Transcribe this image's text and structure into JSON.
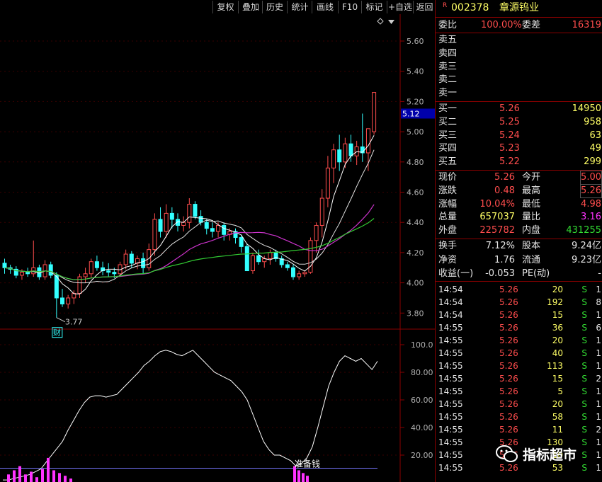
{
  "toolbar": {
    "buttons": [
      "复权",
      "叠加",
      "历史",
      "统计",
      "画线",
      "F10",
      "标记",
      "+自选",
      "返回"
    ]
  },
  "price_axis": {
    "ticks": [
      "5.60",
      "5.40",
      "5.20",
      "5.00",
      "4.80",
      "4.60",
      "4.40",
      "4.20",
      "4.00",
      "3.80"
    ],
    "current_price_tag": "5.12",
    "low_label": "3.77",
    "fin_marker": "财"
  },
  "indicator_axis": {
    "ticks": [
      "100.0",
      "80.00",
      "60.00",
      "40.00",
      "20.00"
    ],
    "bottom_label": "准备钱"
  },
  "colors": {
    "up": "#ff4d4d",
    "down": "#33ffff",
    "ma_white": "#ffffff",
    "ma_magenta": "#cc33cc",
    "ma_green": "#33cc33",
    "frame": "#8a0000"
  },
  "stock": {
    "prefix": "R",
    "code": "002378",
    "name": "章源钨业"
  },
  "ratio": {
    "wb_label": "委比",
    "wb_value": "100.00%",
    "wc_label": "委差",
    "wc_value": "16319"
  },
  "sells": [
    {
      "label": "卖五",
      "price": "",
      "vol": ""
    },
    {
      "label": "卖四",
      "price": "",
      "vol": ""
    },
    {
      "label": "卖三",
      "price": "",
      "vol": ""
    },
    {
      "label": "卖二",
      "price": "",
      "vol": ""
    },
    {
      "label": "卖一",
      "price": "",
      "vol": ""
    }
  ],
  "buys": [
    {
      "label": "买一",
      "price": "5.26",
      "vol": "14950"
    },
    {
      "label": "买二",
      "price": "5.25",
      "vol": "958"
    },
    {
      "label": "买三",
      "price": "5.24",
      "vol": "63"
    },
    {
      "label": "买四",
      "price": "5.23",
      "vol": "49"
    },
    {
      "label": "买五",
      "price": "5.22",
      "vol": "299"
    }
  ],
  "stats": [
    {
      "l1": "现价",
      "v1": "5.26",
      "l2": "今开",
      "v2": "5.00"
    },
    {
      "l1": "涨跌",
      "v1": "0.48",
      "l2": "最高",
      "v2": "5.26"
    },
    {
      "l1": "涨幅",
      "v1": "10.04%",
      "l2": "最低",
      "v2": "4.98"
    },
    {
      "l1": "总量",
      "v1": "657037",
      "l2": "量比",
      "v2": "3.16"
    },
    {
      "l1": "外盘",
      "v1": "225782",
      "l2": "内盘",
      "v2": "431255"
    }
  ],
  "stats2": [
    {
      "l1": "换手",
      "v1": "7.12%",
      "l2": "股本",
      "v2": "9.24亿"
    },
    {
      "l1": "净资",
      "v1": "1.76",
      "l2": "流通",
      "v2": "9.23亿"
    },
    {
      "l1": "收益(一)",
      "v1": "-0.053",
      "l2": "PE(动)",
      "v2": "-"
    }
  ],
  "ticks": [
    {
      "t": "14:54",
      "p": "5.26",
      "v": "20",
      "s": "S",
      "n": "1"
    },
    {
      "t": "14:54",
      "p": "5.26",
      "v": "192",
      "s": "S",
      "n": "8"
    },
    {
      "t": "14:54",
      "p": "5.26",
      "v": "15",
      "s": "S",
      "n": "1"
    },
    {
      "t": "14:55",
      "p": "5.26",
      "v": "36",
      "s": "S",
      "n": "6"
    },
    {
      "t": "14:55",
      "p": "5.26",
      "v": "20",
      "s": "S",
      "n": "1"
    },
    {
      "t": "14:55",
      "p": "5.26",
      "v": "40",
      "s": "S",
      "n": "1"
    },
    {
      "t": "14:55",
      "p": "5.26",
      "v": "113",
      "s": "S",
      "n": "1"
    },
    {
      "t": "14:55",
      "p": "5.26",
      "v": "15",
      "s": "S",
      "n": "2"
    },
    {
      "t": "14:55",
      "p": "5.26",
      "v": "5",
      "s": "S",
      "n": "1"
    },
    {
      "t": "14:55",
      "p": "5.26",
      "v": "20",
      "s": "S",
      "n": "1"
    },
    {
      "t": "14:55",
      "p": "5.26",
      "v": "58",
      "s": "S",
      "n": "1"
    },
    {
      "t": "14:55",
      "p": "5.26",
      "v": "11",
      "s": "S",
      "n": "2"
    },
    {
      "t": "14:55",
      "p": "5.26",
      "v": "130",
      "s": "S",
      "n": "1"
    },
    {
      "t": "14:55",
      "p": "5.26",
      "v": "10",
      "s": "S",
      "n": "1"
    },
    {
      "t": "14:55",
      "p": "5.26",
      "v": "53",
      "s": "S",
      "n": "1"
    }
  ],
  "watermark": "指标超市",
  "chart_data": {
    "type": "candlestick",
    "ylim": [
      3.7,
      5.72
    ],
    "candles": [
      [
        4.13,
        4.16,
        4.06,
        4.1
      ],
      [
        4.1,
        4.12,
        4.06,
        4.09
      ],
      [
        4.09,
        4.11,
        4.03,
        4.05
      ],
      [
        4.05,
        4.09,
        4.02,
        4.07
      ],
      [
        4.07,
        4.1,
        4.04,
        4.06
      ],
      [
        4.06,
        4.28,
        4.04,
        4.1
      ],
      [
        4.1,
        4.12,
        4.02,
        4.04
      ],
      [
        4.04,
        4.15,
        4.02,
        4.12
      ],
      [
        4.12,
        4.14,
        4.03,
        4.05
      ],
      [
        4.05,
        4.07,
        3.77,
        3.9
      ],
      [
        3.9,
        3.96,
        3.84,
        3.86
      ],
      [
        3.86,
        3.92,
        3.83,
        3.9
      ],
      [
        3.9,
        3.95,
        3.86,
        3.93
      ],
      [
        3.93,
        4.06,
        3.9,
        4.04
      ],
      [
        4.04,
        4.1,
        4.0,
        4.06
      ],
      [
        4.06,
        4.16,
        4.03,
        4.14
      ],
      [
        4.14,
        4.18,
        4.08,
        4.1
      ],
      [
        4.1,
        4.14,
        4.05,
        4.08
      ],
      [
        4.08,
        4.13,
        4.04,
        4.07
      ],
      [
        4.07,
        4.1,
        4.03,
        4.06
      ],
      [
        4.06,
        4.14,
        4.04,
        4.12
      ],
      [
        4.12,
        4.22,
        4.09,
        4.19
      ],
      [
        4.19,
        4.21,
        4.1,
        4.13
      ],
      [
        4.13,
        4.18,
        4.09,
        4.16
      ],
      [
        4.16,
        4.2,
        4.06,
        4.1
      ],
      [
        4.1,
        4.26,
        4.08,
        4.22
      ],
      [
        4.22,
        4.46,
        4.18,
        4.42
      ],
      [
        4.42,
        4.5,
        4.3,
        4.34
      ],
      [
        4.34,
        4.52,
        4.3,
        4.46
      ],
      [
        4.46,
        4.5,
        4.36,
        4.42
      ],
      [
        4.42,
        4.46,
        4.34,
        4.38
      ],
      [
        4.38,
        4.44,
        4.34,
        4.4
      ],
      [
        4.4,
        4.56,
        4.36,
        4.52
      ],
      [
        4.52,
        4.54,
        4.42,
        4.44
      ],
      [
        4.44,
        4.48,
        4.38,
        4.4
      ],
      [
        4.4,
        4.42,
        4.32,
        4.36
      ],
      [
        4.36,
        4.4,
        4.3,
        4.34
      ],
      [
        4.34,
        4.4,
        4.3,
        4.38
      ],
      [
        4.38,
        4.4,
        4.28,
        4.32
      ],
      [
        4.32,
        4.36,
        4.28,
        4.34
      ],
      [
        4.34,
        4.36,
        4.26,
        4.3
      ],
      [
        4.3,
        4.32,
        4.2,
        4.24
      ],
      [
        4.24,
        4.26,
        4.1,
        4.08
      ],
      [
        4.08,
        4.2,
        4.06,
        4.18
      ],
      [
        4.18,
        4.22,
        4.12,
        4.14
      ],
      [
        4.14,
        4.18,
        4.1,
        4.16
      ],
      [
        4.16,
        4.22,
        4.12,
        4.2
      ],
      [
        4.2,
        4.22,
        4.14,
        4.16
      ],
      [
        4.16,
        4.18,
        4.1,
        4.12
      ],
      [
        4.12,
        4.14,
        4.08,
        4.1
      ],
      [
        4.1,
        4.12,
        4.02,
        4.04
      ],
      [
        4.04,
        4.08,
        4.02,
        4.06
      ],
      [
        4.06,
        4.08,
        4.04,
        4.07
      ],
      [
        4.07,
        4.3,
        4.06,
        4.28
      ],
      [
        4.28,
        4.4,
        4.2,
        4.38
      ],
      [
        4.38,
        4.62,
        4.3,
        4.56
      ],
      [
        4.56,
        4.84,
        4.5,
        4.76
      ],
      [
        4.76,
        4.92,
        4.66,
        4.88
      ],
      [
        4.88,
        4.98,
        4.74,
        4.8
      ],
      [
        4.8,
        4.96,
        4.76,
        4.92
      ],
      [
        4.92,
        4.98,
        4.8,
        4.84
      ],
      [
        4.84,
        4.94,
        4.78,
        4.9
      ],
      [
        4.9,
        5.12,
        4.8,
        4.86
      ],
      [
        4.86,
        5.0,
        4.74,
        5.02
      ],
      [
        5.0,
        5.26,
        4.98,
        5.26
      ]
    ],
    "osc": [
      2,
      2,
      3,
      4,
      5,
      6,
      8,
      10,
      15,
      20,
      25,
      30,
      38,
      45,
      52,
      58,
      62,
      63,
      63,
      62,
      63,
      64,
      68,
      72,
      76,
      80,
      85,
      88,
      92,
      95,
      96,
      95,
      93,
      92,
      94,
      96,
      92,
      88,
      84,
      80,
      78,
      76,
      74,
      70,
      66,
      60,
      50,
      40,
      30,
      24,
      20,
      20,
      18,
      16,
      12,
      14,
      18,
      26,
      40,
      55,
      70,
      80,
      88,
      92,
      90,
      88,
      90,
      86,
      82,
      88
    ]
  }
}
